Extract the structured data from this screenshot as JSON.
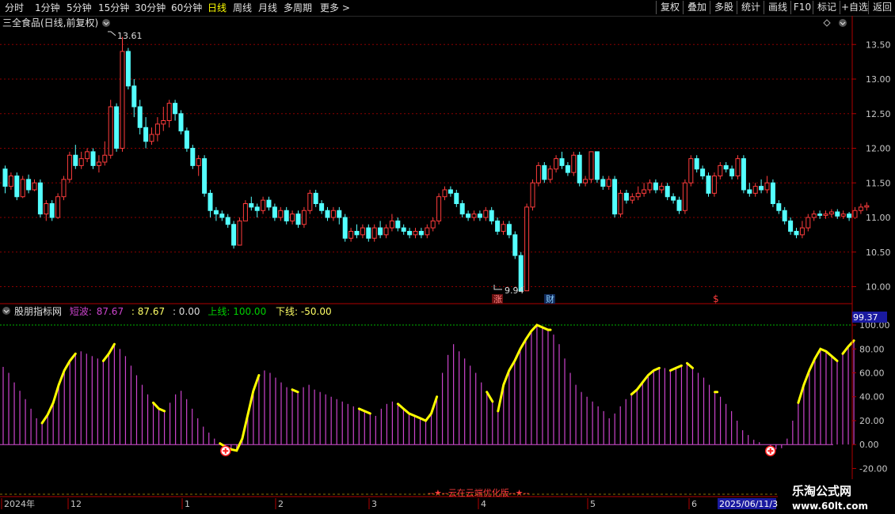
{
  "toolbar": {
    "periods": [
      "分时",
      "1分钟",
      "5分钟",
      "15分钟",
      "30分钟",
      "60分钟",
      "日线",
      "周线",
      "月线",
      "多周期",
      "更多 >"
    ],
    "active_period": "日线",
    "right_buttons": [
      "复权",
      "叠加",
      "多股",
      "统计",
      "画线",
      "F10",
      "标记",
      "+自选",
      "返回"
    ]
  },
  "price_panel": {
    "title": "三全食品(日线,前复权)",
    "high_label": "13.61",
    "low_label": "9.94",
    "markers": {
      "zhang": "涨",
      "cai": "财",
      "dollar": "$"
    },
    "y_ticks": [
      "13.50",
      "13.00",
      "12.50",
      "12.00",
      "11.50",
      "11.00",
      "10.50",
      "10.00"
    ]
  },
  "indicator_panel": {
    "name": "股朋指标网",
    "legend_short_label": "短波:",
    "legend_short_value": "87.67",
    "legend_b": ": 87.67",
    "legend_c": ": 0.00",
    "legend_up": "上线: 100.00",
    "legend_down": "下线: -50.00",
    "current_value_box": "99.37",
    "y_ticks": [
      "100.00",
      "80.00",
      "60.00",
      "40.00",
      "20.00",
      "0.00",
      "-20.00"
    ]
  },
  "bottom": {
    "caption": "--★--云在云端优化版--★--",
    "time_axis": [
      "2024年",
      "12",
      "1",
      "2",
      "3",
      "4",
      "5",
      "6"
    ],
    "date_box": "2025/06/11/3",
    "watermark_title": "乐淘公式网",
    "watermark_url": "www.60lt.com"
  },
  "colors": {
    "up": "#ff3c3c",
    "down": "#54ffff",
    "bar": "#cc44cc",
    "signal": "#ffff00",
    "grid": "#8b0000",
    "axis": "#b00000",
    "upline": "#00b400"
  },
  "chart_data": {
    "type": "candlestick",
    "price_candles": [
      [
        11.7,
        11.45,
        11.75,
        11.35
      ],
      [
        11.45,
        11.6,
        11.65,
        11.4
      ],
      [
        11.6,
        11.3,
        11.65,
        11.25
      ],
      [
        11.3,
        11.55,
        11.6,
        11.28
      ],
      [
        11.55,
        11.4,
        11.62,
        11.35
      ],
      [
        11.4,
        11.5,
        11.55,
        11.38
      ],
      [
        11.5,
        11.05,
        11.55,
        11.0
      ],
      [
        11.05,
        11.2,
        11.25,
        10.95
      ],
      [
        11.2,
        11.0,
        11.25,
        10.95
      ],
      [
        11.0,
        11.3,
        11.35,
        10.98
      ],
      [
        11.3,
        11.55,
        11.6,
        11.25
      ],
      [
        11.55,
        11.9,
        11.95,
        11.5
      ],
      [
        11.9,
        11.75,
        12.05,
        11.7
      ],
      [
        11.75,
        11.85,
        11.95,
        11.7
      ],
      [
        11.85,
        11.95,
        12.0,
        11.8
      ],
      [
        11.95,
        11.75,
        12.0,
        11.7
      ],
      [
        11.75,
        11.8,
        11.9,
        11.65
      ],
      [
        11.8,
        11.9,
        12.1,
        11.75
      ],
      [
        11.9,
        12.6,
        12.7,
        11.85
      ],
      [
        12.6,
        12.0,
        12.65,
        11.95
      ],
      [
        12.0,
        13.4,
        13.61,
        11.95
      ],
      [
        13.4,
        12.9,
        13.45,
        12.85
      ],
      [
        12.9,
        12.6,
        13.0,
        12.45
      ],
      [
        12.6,
        12.3,
        12.7,
        12.2
      ],
      [
        12.3,
        12.1,
        12.45,
        12.0
      ],
      [
        12.1,
        12.2,
        12.3,
        12.05
      ],
      [
        12.2,
        12.35,
        12.45,
        12.1
      ],
      [
        12.35,
        12.4,
        12.6,
        12.25
      ],
      [
        12.4,
        12.65,
        12.7,
        12.3
      ],
      [
        12.65,
        12.5,
        12.7,
        12.4
      ],
      [
        12.5,
        12.25,
        12.55,
        12.2
      ],
      [
        12.25,
        12.0,
        12.3,
        11.95
      ],
      [
        12.0,
        11.75,
        12.05,
        11.7
      ],
      [
        11.75,
        11.85,
        11.9,
        11.6
      ],
      [
        11.85,
        11.35,
        11.9,
        11.3
      ],
      [
        11.35,
        11.1,
        11.4,
        11.0
      ],
      [
        11.1,
        11.05,
        11.15,
        10.95
      ],
      [
        11.05,
        11.0,
        11.1,
        10.95
      ],
      [
        11.0,
        10.9,
        11.05,
        10.85
      ],
      [
        10.9,
        10.6,
        10.95,
        10.55
      ],
      [
        10.6,
        10.95,
        11.0,
        10.6
      ],
      [
        10.95,
        11.2,
        11.25,
        10.95
      ],
      [
        11.2,
        11.15,
        11.3,
        11.1
      ],
      [
        11.15,
        11.1,
        11.2,
        11.0
      ],
      [
        11.1,
        11.25,
        11.3,
        11.05
      ],
      [
        11.25,
        11.15,
        11.3,
        11.1
      ],
      [
        11.15,
        11.0,
        11.2,
        10.95
      ],
      [
        11.0,
        11.1,
        11.15,
        10.95
      ],
      [
        11.1,
        10.95,
        11.15,
        10.9
      ],
      [
        10.95,
        11.05,
        11.1,
        10.9
      ],
      [
        11.05,
        10.9,
        11.1,
        10.85
      ],
      [
        10.9,
        11.1,
        11.15,
        10.85
      ],
      [
        11.1,
        11.35,
        11.4,
        11.05
      ],
      [
        11.35,
        11.2,
        11.4,
        11.15
      ],
      [
        11.2,
        11.1,
        11.25,
        11.05
      ],
      [
        11.1,
        11.0,
        11.15,
        10.95
      ],
      [
        11.0,
        11.1,
        11.15,
        10.95
      ],
      [
        11.1,
        11.0,
        11.15,
        10.9
      ],
      [
        11.0,
        10.7,
        11.05,
        10.65
      ],
      [
        10.7,
        10.8,
        10.85,
        10.65
      ],
      [
        10.8,
        10.75,
        10.9,
        10.7
      ],
      [
        10.75,
        10.85,
        10.9,
        10.7
      ],
      [
        10.85,
        10.7,
        10.9,
        10.65
      ],
      [
        10.7,
        10.85,
        10.9,
        10.65
      ],
      [
        10.85,
        10.75,
        10.95,
        10.7
      ],
      [
        10.75,
        10.85,
        10.9,
        10.7
      ],
      [
        10.85,
        10.95,
        11.05,
        10.8
      ],
      [
        10.95,
        10.85,
        11.0,
        10.8
      ],
      [
        10.85,
        10.8,
        10.9,
        10.75
      ],
      [
        10.8,
        10.75,
        10.85,
        10.7
      ],
      [
        10.75,
        10.8,
        10.85,
        10.7
      ],
      [
        10.8,
        10.75,
        10.85,
        10.7
      ],
      [
        10.75,
        10.85,
        10.9,
        10.7
      ],
      [
        10.85,
        10.95,
        11.0,
        10.8
      ],
      [
        10.95,
        11.3,
        11.35,
        10.9
      ],
      [
        11.3,
        11.4,
        11.45,
        11.25
      ],
      [
        11.4,
        11.35,
        11.45,
        11.3
      ],
      [
        11.35,
        11.2,
        11.4,
        11.15
      ],
      [
        11.2,
        11.05,
        11.25,
        11.0
      ],
      [
        11.05,
        11.0,
        11.1,
        10.95
      ],
      [
        11.0,
        11.05,
        11.1,
        10.95
      ],
      [
        11.05,
        11.0,
        11.1,
        10.95
      ],
      [
        11.0,
        11.1,
        11.15,
        10.95
      ],
      [
        11.1,
        10.95,
        11.15,
        10.9
      ],
      [
        10.95,
        10.8,
        11.0,
        10.75
      ],
      [
        10.8,
        10.9,
        10.95,
        10.75
      ],
      [
        10.9,
        10.75,
        10.95,
        10.7
      ],
      [
        10.75,
        10.45,
        10.8,
        10.4
      ],
      [
        10.45,
        9.94,
        10.5,
        9.94
      ],
      [
        9.94,
        11.15,
        11.2,
        9.94
      ],
      [
        11.15,
        11.5,
        11.55,
        11.1
      ],
      [
        11.5,
        11.75,
        11.8,
        11.45
      ],
      [
        11.75,
        11.55,
        11.8,
        11.5
      ],
      [
        11.55,
        11.7,
        11.75,
        11.5
      ],
      [
        11.7,
        11.85,
        11.9,
        11.65
      ],
      [
        11.85,
        11.75,
        11.95,
        11.7
      ],
      [
        11.75,
        11.65,
        11.8,
        11.6
      ],
      [
        11.65,
        11.9,
        11.95,
        11.6
      ],
      [
        11.9,
        11.5,
        11.95,
        11.45
      ],
      [
        11.5,
        11.55,
        11.6,
        11.45
      ],
      [
        11.55,
        11.95,
        11.95,
        11.5
      ],
      [
        11.95,
        11.55,
        11.95,
        11.5
      ],
      [
        11.55,
        11.45,
        11.6,
        11.4
      ],
      [
        11.45,
        11.55,
        11.6,
        11.4
      ],
      [
        11.55,
        11.05,
        11.6,
        11.0
      ],
      [
        11.05,
        11.35,
        11.4,
        11.0
      ],
      [
        11.35,
        11.25,
        11.4,
        11.2
      ],
      [
        11.25,
        11.3,
        11.35,
        11.2
      ],
      [
        11.3,
        11.35,
        11.45,
        11.25
      ],
      [
        11.35,
        11.4,
        11.5,
        11.3
      ],
      [
        11.4,
        11.5,
        11.55,
        11.35
      ],
      [
        11.5,
        11.4,
        11.55,
        11.35
      ],
      [
        11.4,
        11.45,
        11.5,
        11.35
      ],
      [
        11.45,
        11.3,
        11.5,
        11.25
      ],
      [
        11.3,
        11.25,
        11.35,
        11.2
      ],
      [
        11.25,
        11.1,
        11.3,
        11.05
      ],
      [
        11.1,
        11.5,
        11.55,
        11.05
      ],
      [
        11.5,
        11.85,
        11.9,
        11.45
      ],
      [
        11.85,
        11.7,
        11.9,
        11.65
      ],
      [
        11.7,
        11.6,
        11.75,
        11.55
      ],
      [
        11.6,
        11.35,
        11.65,
        11.3
      ],
      [
        11.35,
        11.6,
        11.65,
        11.3
      ],
      [
        11.6,
        11.75,
        11.8,
        11.55
      ],
      [
        11.75,
        11.7,
        11.8,
        11.65
      ],
      [
        11.7,
        11.6,
        11.75,
        11.55
      ],
      [
        11.6,
        11.85,
        11.9,
        11.55
      ],
      [
        11.85,
        11.4,
        11.9,
        11.35
      ],
      [
        11.4,
        11.35,
        11.5,
        11.3
      ],
      [
        11.35,
        11.45,
        11.5,
        11.3
      ],
      [
        11.45,
        11.4,
        11.55,
        11.35
      ],
      [
        11.4,
        11.5,
        11.6,
        11.35
      ],
      [
        11.5,
        11.2,
        11.55,
        11.15
      ],
      [
        11.2,
        11.1,
        11.25,
        11.05
      ],
      [
        11.1,
        10.95,
        11.15,
        10.9
      ],
      [
        10.95,
        10.8,
        11.0,
        10.75
      ],
      [
        10.8,
        10.75,
        10.85,
        10.7
      ],
      [
        10.75,
        10.85,
        10.95,
        10.7
      ],
      [
        10.85,
        11.0,
        11.05,
        10.8
      ],
      [
        11.0,
        11.05,
        11.1,
        10.95
      ],
      [
        11.05,
        11.03,
        11.1,
        10.98
      ],
      [
        11.03,
        11.05,
        11.1,
        10.98
      ],
      [
        11.05,
        11.08,
        11.12,
        11.0
      ],
      [
        11.08,
        11.02,
        11.12,
        10.98
      ],
      [
        11.02,
        11.05,
        11.1,
        10.98
      ],
      [
        11.05,
        11.0,
        11.08,
        10.95
      ],
      [
        11.0,
        11.1,
        11.15,
        10.98
      ],
      [
        11.1,
        11.15,
        11.2,
        11.05
      ],
      [
        11.15,
        11.17,
        11.22,
        11.1
      ]
    ],
    "short_wave": [
      65,
      60,
      52,
      45,
      38,
      30,
      22,
      18,
      25,
      35,
      50,
      62,
      70,
      76,
      78,
      76,
      74,
      72,
      70,
      76,
      84,
      80,
      74,
      66,
      58,
      50,
      42,
      35,
      30,
      28,
      35,
      42,
      45,
      38,
      30,
      22,
      15,
      10,
      5,
      1,
      -2,
      -4,
      -5,
      5,
      25,
      45,
      58,
      62,
      60,
      56,
      52,
      48,
      46,
      44,
      48,
      50,
      46,
      44,
      42,
      40,
      38,
      36,
      34,
      32,
      30,
      28,
      26,
      24,
      30,
      34,
      36,
      34,
      30,
      26,
      24,
      22,
      20,
      26,
      40,
      60,
      75,
      84,
      78,
      72,
      66,
      60,
      52,
      44,
      36,
      28,
      50,
      62,
      70,
      80,
      88,
      95,
      100,
      98,
      96,
      92,
      84,
      72,
      60,
      50,
      44,
      40,
      36,
      32,
      28,
      22,
      26,
      32,
      38,
      42,
      46,
      52,
      58,
      62,
      64,
      64,
      62,
      64,
      66,
      68,
      64,
      60,
      56,
      50,
      44,
      40,
      34,
      28,
      20,
      12,
      8,
      4,
      2,
      0,
      -2,
      -4,
      -3,
      5,
      20,
      35,
      50,
      62,
      72,
      80,
      78,
      74,
      70,
      76,
      82,
      87
    ],
    "price_axis_ticks": [
      13.5,
      13.0,
      12.5,
      12.0,
      11.5,
      11.0,
      10.5,
      10.0
    ],
    "indicator_axis_ticks": [
      100,
      80,
      60,
      40,
      20,
      0,
      -20
    ]
  }
}
